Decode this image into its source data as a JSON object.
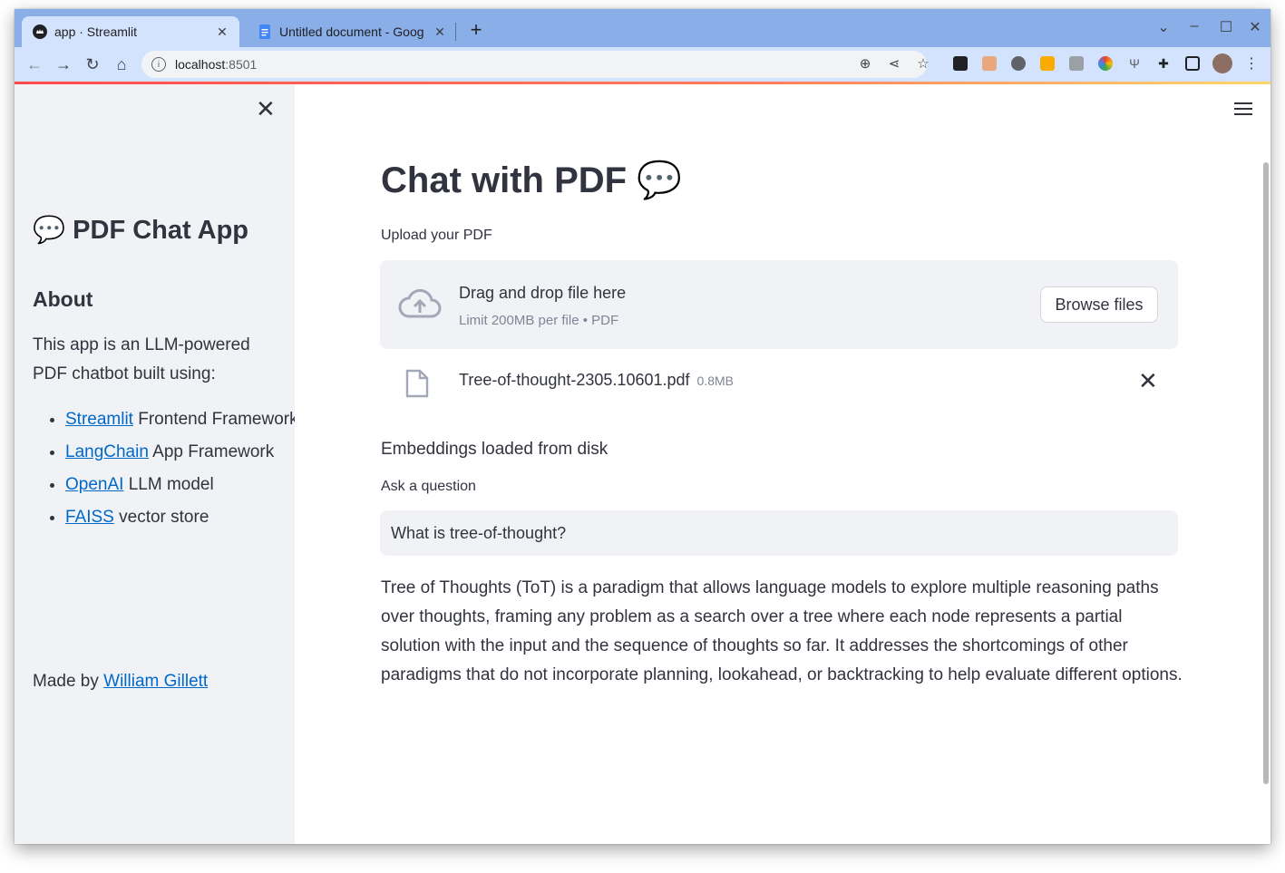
{
  "browser": {
    "tabs": [
      {
        "title": "app · Streamlit",
        "active": true,
        "favicon": "streamlit-crown-icon"
      },
      {
        "title": "Untitled document - Goog",
        "active": false,
        "favicon": "google-docs-icon"
      }
    ],
    "url_host": "localhost",
    "url_port": ":8501"
  },
  "sidebar": {
    "title": "💬 PDF Chat App",
    "about_heading": "About",
    "description": "This app is an LLM-powered PDF chatbot built using:",
    "items": [
      {
        "link": "Streamlit",
        "text": " Frontend Framework"
      },
      {
        "link": "LangChain",
        "text": " App Framework"
      },
      {
        "link": "OpenAI",
        "text": " LLM model"
      },
      {
        "link": "FAISS",
        "text": " vector store"
      }
    ],
    "made_by_prefix": "Made by ",
    "made_by_link": "William Gillett"
  },
  "main": {
    "title": "Chat with PDF 💬",
    "upload_label": "Upload your PDF",
    "dropzone": {
      "main_text": "Drag and drop file here",
      "sub_text": "Limit 200MB per file • PDF",
      "browse_label": "Browse files"
    },
    "file": {
      "name": "Tree-of-thought-2305.10601.pdf",
      "size": "0.8MB"
    },
    "status": "Embeddings loaded from disk",
    "question_label": "Ask a question",
    "question_value": "What is tree-of-thought?",
    "answer": "Tree of Thoughts (ToT) is a paradigm that allows language models to explore multiple reasoning paths over thoughts, framing any problem as a search over a tree where each node represents a partial solution with the input and the sequence of thoughts so far. It addresses the shortcomings of other paradigms that do not incorporate planning, lookahead, or backtracking to help evaluate different options."
  },
  "colors": {
    "tabstrip": "#8aaee8",
    "toolbar": "#d3e3fd",
    "sidebar_bg": "#f0f2f6",
    "text": "#31333f",
    "link": "#0068c9"
  }
}
